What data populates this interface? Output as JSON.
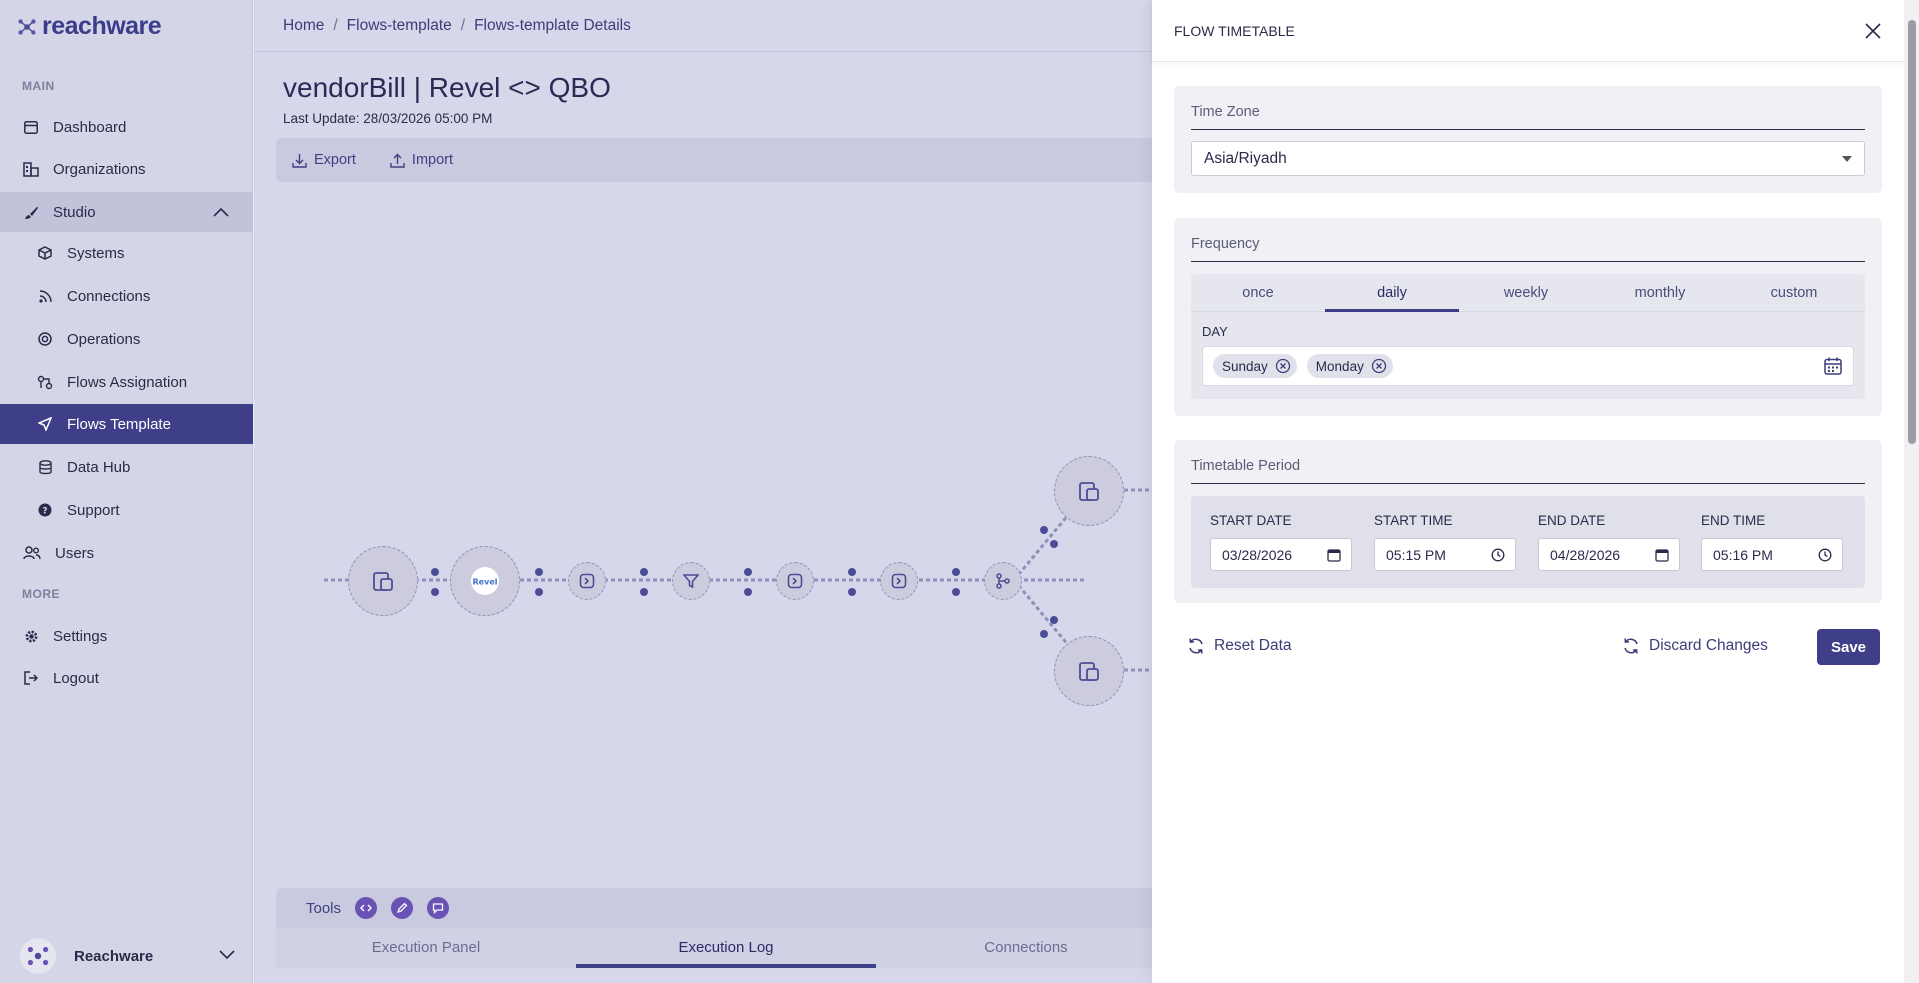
{
  "app": {
    "brand": "reachware"
  },
  "sidebar": {
    "section_main": "MAIN",
    "section_more": "MORE",
    "items": [
      {
        "label": "Dashboard",
        "icon": "dashboard-icon"
      },
      {
        "label": "Organizations",
        "icon": "organizations-icon"
      },
      {
        "label": "Studio",
        "icon": "brush-icon"
      },
      {
        "label": "Systems",
        "icon": "cube-icon"
      },
      {
        "label": "Connections",
        "icon": "rss-icon"
      },
      {
        "label": "Operations",
        "icon": "target-icon"
      },
      {
        "label": "Flows Assignation",
        "icon": "flows-assign-icon"
      },
      {
        "label": "Flows Template",
        "icon": "send-icon"
      },
      {
        "label": "Data Hub",
        "icon": "database-icon"
      },
      {
        "label": "Support",
        "icon": "help-icon"
      },
      {
        "label": "Users",
        "icon": "users-icon"
      },
      {
        "label": "Settings",
        "icon": "gear-icon"
      },
      {
        "label": "Logout",
        "icon": "logout-icon"
      }
    ],
    "account_name": "Reachware"
  },
  "breadcrumb": [
    "Home",
    "Flows-template",
    "Flows-template Details"
  ],
  "page": {
    "title": "vendorBill | Revel <> QBO",
    "last_update": "Last Update: 28/03/2026 05:00 PM",
    "export_label": "Export",
    "import_label": "Import"
  },
  "bottom": {
    "tools_label": "Tools",
    "tabs": [
      "Execution Panel",
      "Execution Log",
      "Connections"
    ],
    "active_tab": "Execution Log"
  },
  "panel": {
    "title": "FLOW TIMETABLE",
    "timezone_label": "Time Zone",
    "timezone_value": "Asia/Riyadh",
    "frequency_label": "Frequency",
    "frequency_tabs": [
      "once",
      "daily",
      "weekly",
      "monthly",
      "custom"
    ],
    "active_frequency": "daily",
    "day_label": "DAY",
    "days": [
      "Sunday",
      "Monday"
    ],
    "period_label": "Timetable Period",
    "start_date_label": "START DATE",
    "start_date": "03/28/2026",
    "start_time_label": "START TIME",
    "start_time": "05:15 PM",
    "end_date_label": "END DATE",
    "end_date": "04/28/2026",
    "end_time_label": "END TIME",
    "end_time": "05:16 PM",
    "reset_label": "Reset Data",
    "discard_label": "Discard Changes",
    "save_label": "Save"
  },
  "colors": {
    "accent": "#3e3f88",
    "sidebar_bg": "#d4d5e6",
    "tool_purple": "#6a52b4"
  }
}
